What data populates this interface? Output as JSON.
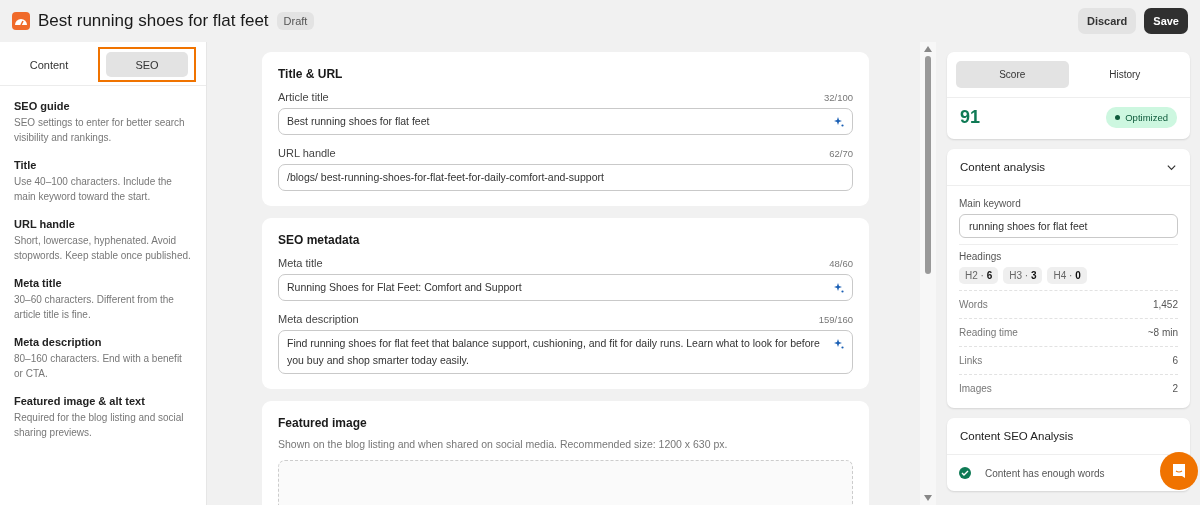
{
  "header": {
    "title": "Best running shoes for flat feet",
    "status": "Draft",
    "buttons": [
      {
        "label": "Discard",
        "kind": "secondary"
      },
      {
        "label": "Save",
        "kind": "primary"
      }
    ]
  },
  "sidebar": {
    "tabs": [
      {
        "label": "Content",
        "selected": false
      },
      {
        "label": "SEO",
        "selected": true
      }
    ],
    "guide": [
      {
        "title": "SEO guide",
        "text": "SEO settings to enter for better search visibility and rankings."
      },
      {
        "title": "Title",
        "text": "Use 40–100 characters. Include the main keyword toward the start."
      },
      {
        "title": "URL handle",
        "text": "Short, lowercase, hyphenated. Avoid stopwords. Keep stable once published."
      },
      {
        "title": "Meta title",
        "text": "30–60 characters. Different from the article title is fine."
      },
      {
        "title": "Meta description",
        "text": "80–160 characters. End with a benefit or CTA."
      },
      {
        "title": "Featured image & alt text",
        "text": "Required for the blog listing and social sharing previews."
      }
    ]
  },
  "cards": [
    {
      "title": "Title & URL",
      "fields": [
        {
          "label": "Article title",
          "count": "32/100",
          "value": "Best running shoes for flat feet",
          "kind": "ai"
        },
        {
          "label": "URL handle",
          "count": "62/70",
          "prefix": "/blogs/",
          "value": "best-running-shoes-for-flat-feet-for-daily-comfort-and-support",
          "kind": "url"
        }
      ]
    },
    {
      "title": "SEO metadata",
      "fields": [
        {
          "label": "Meta title",
          "count": "48/60",
          "value": "Running Shoes for Flat Feet: Comfort and Support",
          "kind": "ai"
        },
        {
          "label": "Meta description",
          "count": "159/160",
          "value": "Find running shoes for flat feet that balance support, cushioning, and fit for daily runs. Learn what to look for before you buy and shop smarter today easily.",
          "kind": "textarea"
        }
      ]
    },
    {
      "title": "Featured image",
      "description": "Shown on the blog listing and when shared on social media. Recommended size: 1200 x 630 px.",
      "upload": true
    }
  ],
  "score_panel": {
    "tabs": [
      {
        "label": "Score",
        "selected": true
      },
      {
        "label": "History",
        "selected": false
      }
    ],
    "score": "91",
    "status": "Optimized"
  },
  "content_analysis": {
    "title": "Content analysis",
    "expanded": true,
    "keyword_label": "Main keyword",
    "keyword": "running shoes for flat feet",
    "headings_label": "Headings",
    "headings": [
      "H2 · **6**",
      "H3 · **3**",
      "H4 · **0**"
    ],
    "stats": [
      {
        "label": "Words",
        "value": "1,452"
      },
      {
        "label": "Reading time",
        "value": "~8 min"
      },
      {
        "label": "Links",
        "value": "6"
      },
      {
        "label": "Images",
        "value": "2"
      }
    ]
  },
  "seo_analysis": {
    "title": "Content SEO Analysis",
    "checks": [
      {
        "text": "Content has enough words",
        "passed": true
      }
    ]
  }
}
